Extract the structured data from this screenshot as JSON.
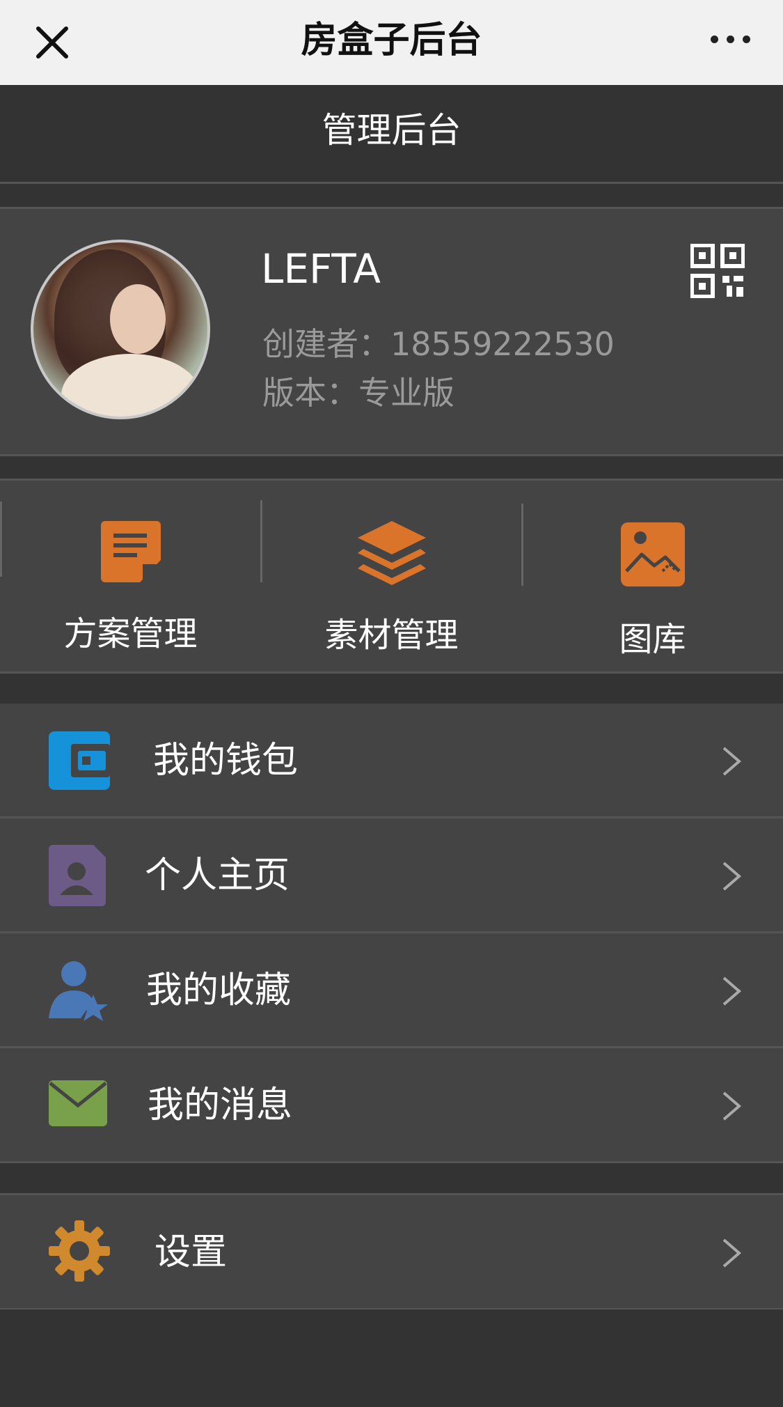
{
  "topbar": {
    "title": "房盒子后台"
  },
  "header": {
    "title": "管理后台"
  },
  "profile": {
    "name": "LEFTA",
    "creator": "创建者：18559222530",
    "version": "版本：专业版"
  },
  "quick_actions": [
    {
      "label": "方案管理",
      "icon": "document-icon",
      "color": "#d9742a"
    },
    {
      "label": "素材管理",
      "icon": "layers-icon",
      "color": "#d9742a"
    },
    {
      "label": "图库",
      "icon": "image-icon",
      "color": "#d9742a"
    }
  ],
  "menu": {
    "items": [
      {
        "label": "我的钱包",
        "icon": "wallet-icon",
        "color": "#1592d9"
      },
      {
        "label": "个人主页",
        "icon": "profile-page-icon",
        "color": "#6c5b86"
      },
      {
        "label": "我的收藏",
        "icon": "favorite-user-icon",
        "color": "#4a77b6"
      },
      {
        "label": "我的消息",
        "icon": "mail-icon",
        "color": "#79a04a"
      }
    ],
    "settings": {
      "label": "设置",
      "icon": "gear-icon",
      "color": "#d1892e"
    }
  }
}
